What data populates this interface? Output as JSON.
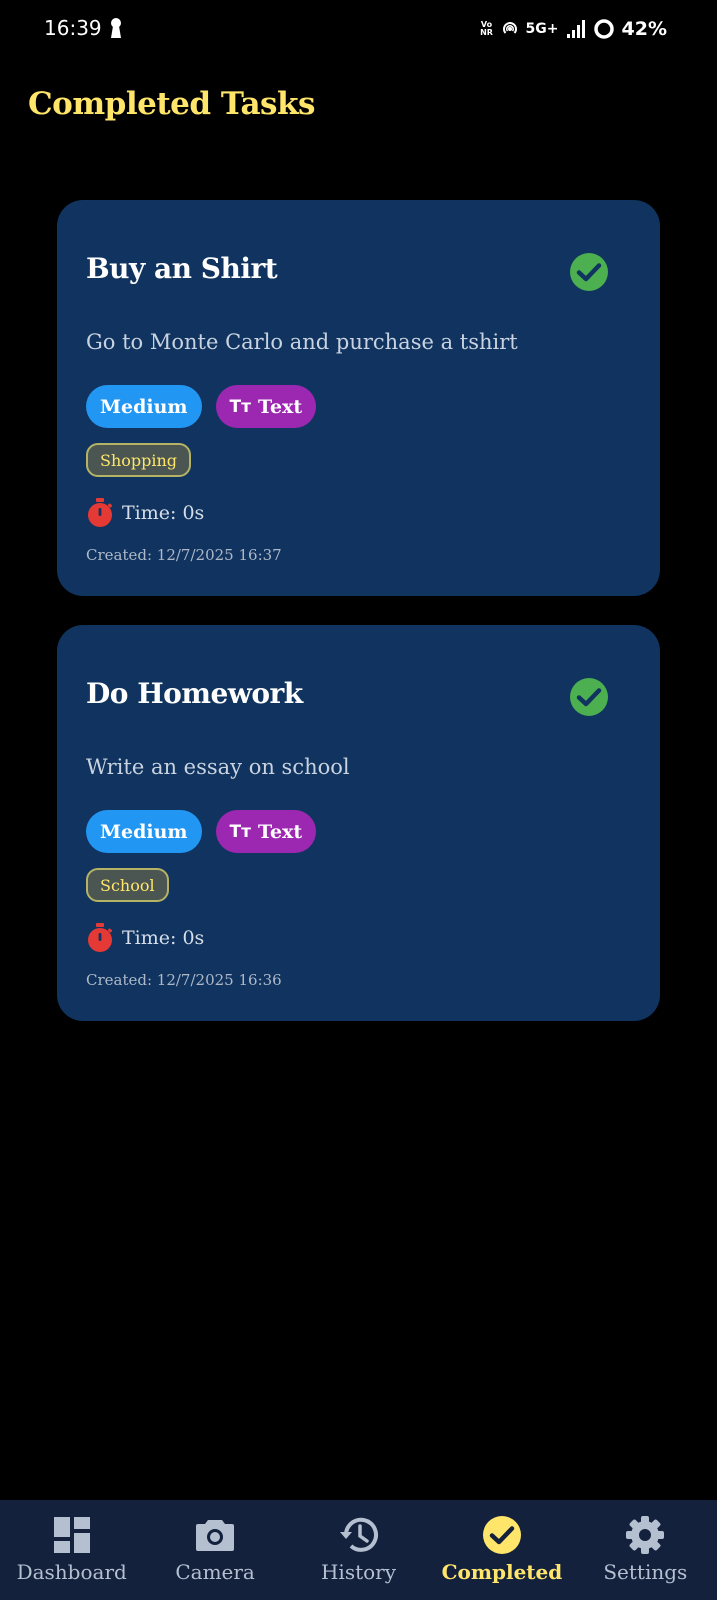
{
  "status_bar": {
    "time": "16:39",
    "volte_top": "Vo",
    "volte_bottom": "NR",
    "network": "5G+",
    "battery": "42%"
  },
  "page": {
    "title": "Completed Tasks"
  },
  "tasks": [
    {
      "title": "Buy an Shirt",
      "description": "Go to Monte Carlo and purchase a tshirt",
      "priority": "Medium",
      "type_icon": "Tт",
      "type": "Text",
      "category": "Shopping",
      "time": "Time: 0s",
      "created": "Created: 12/7/2025 16:37"
    },
    {
      "title": "Do Homework",
      "description": "Write an essay on school",
      "priority": "Medium",
      "type_icon": "Tт",
      "type": "Text",
      "category": "School",
      "time": "Time: 0s",
      "created": "Created: 12/7/2025 16:36"
    }
  ],
  "nav": {
    "items": [
      {
        "label": "Dashboard",
        "icon": "dashboard-icon"
      },
      {
        "label": "Camera",
        "icon": "camera-icon"
      },
      {
        "label": "History",
        "icon": "history-icon"
      },
      {
        "label": "Completed",
        "icon": "check-circle-icon"
      },
      {
        "label": "Settings",
        "icon": "gear-icon"
      }
    ],
    "active": "Completed"
  },
  "colors": {
    "accent": "#ffe66a",
    "card": "#10345f",
    "priority_chip": "#2196f3",
    "type_chip": "#9c27b0",
    "check": "#4caf50",
    "timer": "#e53935",
    "nav_bg": "#14213d"
  }
}
